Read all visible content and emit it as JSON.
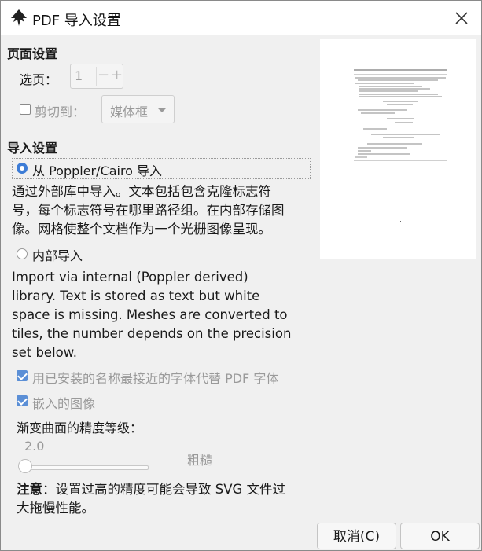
{
  "window": {
    "title": "PDF 导入设置"
  },
  "page_settings": {
    "heading": "页面设置",
    "select_page_label": "选页：",
    "page_value": "1",
    "minus": "−",
    "plus": "+",
    "clip_label": "剪切到：",
    "clip_checked": false,
    "clip_option": "媒体框"
  },
  "import_settings": {
    "heading": "导入设置",
    "option_poppler": {
      "label": "从 Poppler/Cairo 导入",
      "selected": true,
      "description_lines": [
        "通过外部库中导入。文本包括包含克隆标志符",
        "号，每个标志符号在哪里路径组。在内部存储图",
        "像。网格使整个文档作为一个光栅图像呈现。"
      ]
    },
    "option_internal": {
      "label": "内部导入",
      "selected": false,
      "description_lines": [
        "Import via internal (Poppler derived)",
        "library. Text is stored as text but white",
        "space is missing. Meshes are converted to",
        "tiles, the number depends on the precision",
        "set below."
      ]
    },
    "replace_fonts_label": "用已安装的名称最接近的字体代替 PDF 字体",
    "replace_fonts_checked": true,
    "embed_images_label": "嵌入的图像",
    "embed_images_checked": true,
    "precision_label": "渐变曲面的精度等级：",
    "precision_value": "2.0",
    "precision_level": 0,
    "precision_quality": "粗糙",
    "note_bold": "注意",
    "note_lines": [
      "：设置过高的精度可能会导致 SVG 文件过",
      "大拖慢性能。"
    ]
  },
  "buttons": {
    "cancel": "取消(C)",
    "ok": "OK"
  },
  "colors": {
    "accent": "#3d7cd6",
    "check": "#5b8fd6",
    "disabled": "#9a9a9a"
  }
}
